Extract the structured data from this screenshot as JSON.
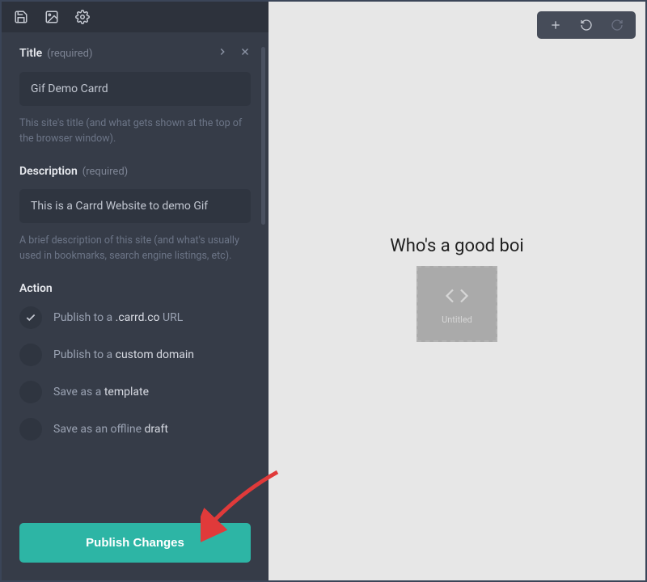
{
  "sidebar": {
    "title_section": {
      "label": "Title",
      "required": "(required)",
      "value": "Gif Demo Carrd",
      "hint": "This site's title (and what gets shown at the top of the browser window)."
    },
    "description_section": {
      "label": "Description",
      "required": "(required)",
      "value": "This is a Carrd Website to demo Gif",
      "hint": "A brief description of this site (and what's usually used in bookmarks, search engine listings, etc)."
    },
    "action_section": {
      "label": "Action",
      "options": [
        {
          "pre": "Publish to a ",
          "em": ".carrd.co",
          "post": " URL",
          "selected": true
        },
        {
          "pre": "Publish to a ",
          "em": "custom domain",
          "post": "",
          "selected": false
        },
        {
          "pre": "Save as a ",
          "em": "template",
          "post": "",
          "selected": false
        },
        {
          "pre": "Save as an offline ",
          "em": "draft",
          "post": "",
          "selected": false
        }
      ]
    },
    "publish_button": "Publish Changes"
  },
  "canvas": {
    "heading": "Who's a good boi",
    "embed_label": "Untitled"
  }
}
